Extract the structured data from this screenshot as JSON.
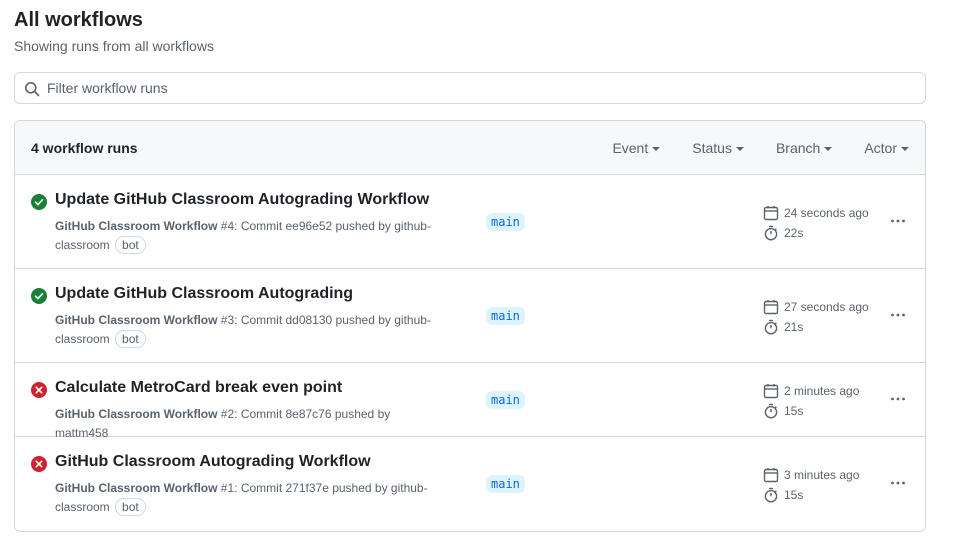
{
  "header": {
    "title": "All workflows",
    "subtitle": "Showing runs from all workflows"
  },
  "search": {
    "placeholder": "Filter workflow runs",
    "value": ""
  },
  "runs_header": {
    "count_label": "4 workflow runs",
    "filters": [
      "Event",
      "Status",
      "Branch",
      "Actor"
    ]
  },
  "colors": {
    "success": "#1a7f37",
    "failure": "#cf222e",
    "branch_bg": "#ddf4ff",
    "branch_text": "#0969da"
  },
  "runs": [
    {
      "status": "success",
      "title": "Update GitHub Classroom Autograding Workflow",
      "workflow": "GitHub Classroom Workflow",
      "details": " #4: Commit ee96e52 pushed by github-classroom",
      "bot": "bot",
      "branch": "main",
      "time_ago": "24 seconds ago",
      "duration": "22s"
    },
    {
      "status": "success",
      "title": "Update GitHub Classroom Autograding",
      "workflow": "GitHub Classroom Workflow",
      "details": " #3: Commit dd08130 pushed by github-classroom",
      "bot": "bot",
      "branch": "main",
      "time_ago": "27 seconds ago",
      "duration": "21s"
    },
    {
      "status": "failure",
      "title": "Calculate MetroCard break even point",
      "workflow": "GitHub Classroom Workflow",
      "details": " #2: Commit 8e87c76 pushed by mattm458",
      "branch": "main",
      "time_ago": "2 minutes ago",
      "duration": "15s"
    },
    {
      "status": "failure",
      "title": "GitHub Classroom Autograding Workflow",
      "workflow": "GitHub Classroom Workflow",
      "details": " #1: Commit 271f37e pushed by github-classroom",
      "bot": "bot",
      "branch": "main",
      "time_ago": "3 minutes ago",
      "duration": "15s"
    }
  ],
  "icons": {
    "success": "check-circle-fill-icon",
    "failure": "x-circle-fill-icon",
    "calendar": "calendar-icon",
    "duration": "stopwatch-icon",
    "more": "kebab-horizontal-icon",
    "search": "search-icon"
  }
}
